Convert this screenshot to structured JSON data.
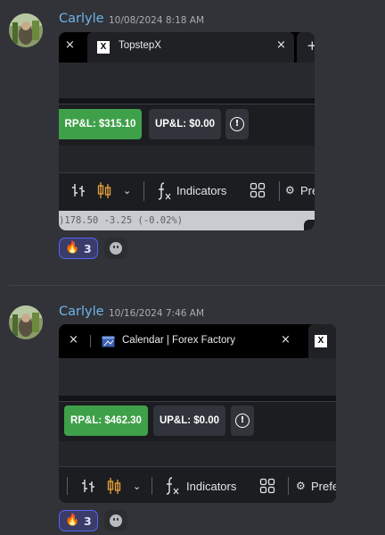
{
  "messages": [
    {
      "author": "Carlyle",
      "timestamp": "10/08/2024 8:18 AM",
      "tabs": [
        {
          "favicon": "X",
          "title": "TopstepX"
        }
      ],
      "pnl": {
        "rpl": "RP&L: $315.10",
        "upl": "UP&L: $0.00"
      },
      "toolbar": {
        "indicators": "Indicators",
        "prefs": "Pre"
      },
      "quote_line": ")178.50 -3.25 (-0.02%)",
      "reaction": {
        "emoji": "🔥",
        "count": "3"
      }
    },
    {
      "author": "Carlyle",
      "timestamp": "10/16/2024 7:46 AM",
      "tabs": [
        {
          "favicon": "calendar",
          "title": "Calendar | Forex Factory"
        },
        {
          "favicon": "X",
          "title": ""
        }
      ],
      "pnl": {
        "rpl": "RP&L: $462.30",
        "upl": "UP&L: $0.00"
      },
      "toolbar": {
        "indicators": "Indicators",
        "prefs": "Prefe"
      },
      "reaction": {
        "emoji": "🔥",
        "count": "3"
      }
    }
  ],
  "icons": {
    "close": "×",
    "plus": "+",
    "alert": "!",
    "gear": "⚙",
    "function": "fx",
    "layout": "grid",
    "candles": "candlestick",
    "add-reaction": "smile"
  },
  "colors": {
    "accent_green": "#3fa04a",
    "author": "#6fb3e8",
    "reaction_border": "#5865f2"
  }
}
